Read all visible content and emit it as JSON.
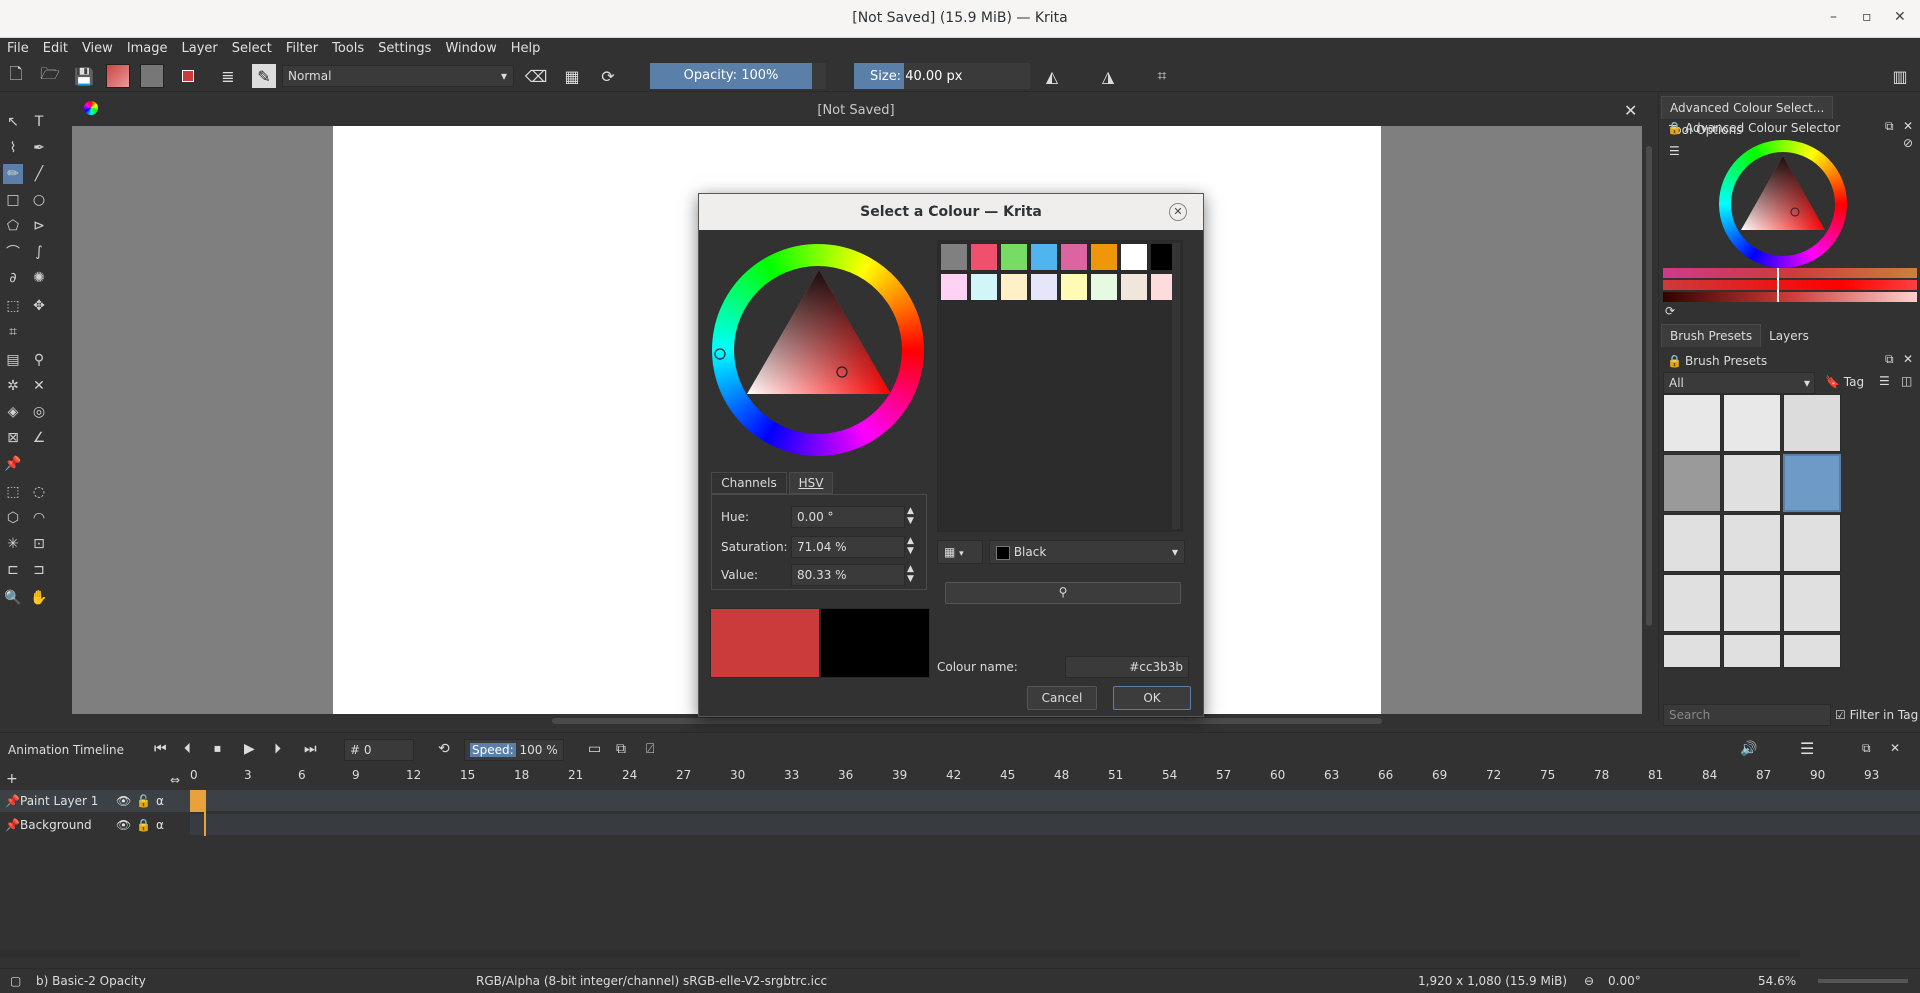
{
  "window": {
    "title": "[Not Saved]  (15.9 MiB)  — Krita"
  },
  "menu": [
    "File",
    "Edit",
    "View",
    "Image",
    "Layer",
    "Select",
    "Filter",
    "Tools",
    "Settings",
    "Window",
    "Help"
  ],
  "toolbar": {
    "blend_mode": "Normal",
    "opacity": "Opacity: 100%",
    "size": "Size: 40.00 px",
    "opacity_fraction": 1.0
  },
  "canvas": {
    "title": "[Not Saved]"
  },
  "dock": {
    "top_tabs": [
      "Advanced Colour Select...",
      "Tool Options"
    ],
    "selector_title": "Advanced Colour Selector",
    "mid_tabs": [
      "Brush Presets",
      "Layers"
    ],
    "presets_title": "Brush Presets",
    "filter": "All",
    "tag": "Tag",
    "search_placeholder": "Search",
    "filter_in_tag": "Filter in Tag"
  },
  "dialog": {
    "title": "Select a Colour — Krita",
    "tabs": [
      "Channels",
      "HSV"
    ],
    "hue_label": "Hue:",
    "hue": "0.00 °",
    "sat_label": "Saturation:",
    "sat": "71.04 %",
    "val_label": "Value:",
    "val": "80.33 %",
    "palette_name": "Black",
    "colour_name_label": "Colour name:",
    "colour_name": "#cc3b3b",
    "cancel": "Cancel",
    "ok": "OK",
    "swatches": [
      "#808080",
      "#f0506e",
      "#78dc64",
      "#50b4f0",
      "#dc64a0",
      "#f0960a",
      "#ffffff",
      "#000000",
      "#ffd2f5",
      "#d2f5fa",
      "#fff0c8",
      "#e6e6fa",
      "#fffab4",
      "#e6fae1",
      "#f0e6dc",
      "#ffdcdc"
    ],
    "current_colour": "#cc3b3b",
    "previous_colour": "#000000"
  },
  "timeline": {
    "title": "Animation Timeline",
    "frame": "0",
    "speed_label": "Speed:",
    "speed": "100 %",
    "layers": [
      "Paint Layer 1",
      "Background"
    ],
    "frame_numbers": [
      "0",
      "3",
      "6",
      "9",
      "12",
      "15",
      "18",
      "21",
      "24",
      "27",
      "30",
      "33",
      "36",
      "39",
      "42",
      "45",
      "48",
      "51",
      "54",
      "57",
      "60",
      "63",
      "66",
      "69",
      "72",
      "75",
      "78",
      "81",
      "84",
      "87",
      "90",
      "93"
    ]
  },
  "status": {
    "brush": "b) Basic-2 Opacity",
    "colorspace": "RGB/Alpha (8-bit integer/channel)  sRGB-elle-V2-srgbtrc.icc",
    "dimensions": "1,920 x 1,080 (15.9 MiB)",
    "rotation": "0.00°",
    "zoom": "54.6%"
  }
}
